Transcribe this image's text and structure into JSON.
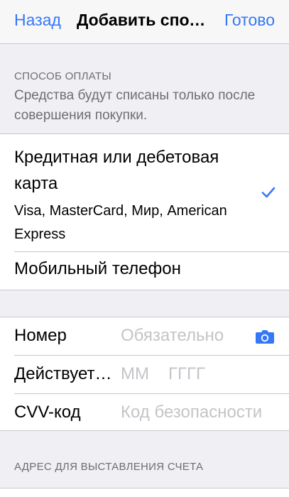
{
  "navbar": {
    "back_label": "Назад",
    "title": "Добавить способ оплаты",
    "done_label": "Готово",
    "accent_color": "#3478f6"
  },
  "payment_method": {
    "header": "СПОСОБ ОПЛАТЫ",
    "footnote": "Средства будут списаны только после совершения покупки.",
    "options": [
      {
        "title": "Кредитная или дебетовая карта",
        "subtitle": "Visa, MasterCard, Мир, American Express",
        "selected": true,
        "icon": "checkmark-icon"
      },
      {
        "title": "Мобильный телефон",
        "selected": false
      }
    ]
  },
  "card_form": {
    "number": {
      "label": "Номер",
      "value": "",
      "placeholder": "Обязательно",
      "icon": "camera-icon"
    },
    "expiry": {
      "label": "Действует до",
      "month_placeholder": "ММ",
      "year_placeholder": "ГГГГ",
      "month_value": "",
      "year_value": ""
    },
    "cvv": {
      "label": "CVV-код",
      "value": "",
      "placeholder": "Код безопасности"
    }
  },
  "billing": {
    "header": "АДРЕС ДЛЯ ВЫСТАВЛЕНИЯ СЧЕТА"
  }
}
